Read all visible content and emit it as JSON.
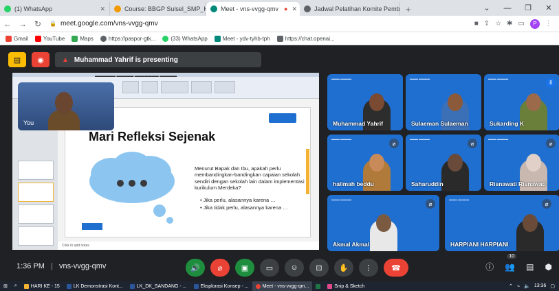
{
  "browser": {
    "tabs": [
      {
        "label": "(1) WhatsApp",
        "color": "#25d366",
        "active": false
      },
      {
        "label": "Course: BBGP Sulsel_SMP_Kelas_",
        "color": "#f29900",
        "active": false
      },
      {
        "label": "Meet - vns-vvgg-qmv",
        "color": "#00897b",
        "active": true
      },
      {
        "label": "Jadwal Pelatihan Komite Pembel",
        "color": "#5f6368",
        "active": false
      }
    ],
    "new_tab": "+",
    "url": "meet.google.com/vns-vvgg-qmv",
    "bookmarks": [
      {
        "label": "Gmail",
        "color": "#ea4335"
      },
      {
        "label": "YouTube",
        "color": "#ff0000"
      },
      {
        "label": "Maps",
        "color": "#34a853"
      },
      {
        "label": "https://paspor-gtk...",
        "color": "#5f6368"
      },
      {
        "label": "(33) WhatsApp",
        "color": "#25d366"
      },
      {
        "label": "Meet - ydv-tyhb-tph",
        "color": "#00897b"
      },
      {
        "label": "https://chat.openai...",
        "color": "#5f6368"
      }
    ],
    "profile_initial": "P"
  },
  "meet": {
    "presenting_label": "Muhammad Yahrif is presenting",
    "you_label": "You",
    "slide": {
      "title": "Mari Refleksi Sejenak",
      "question": "Menurut Bapak dan Ibu, apakah perlu membandingkan-bandingkan capaian sekolah sendiri dengan sekolah lain dalam implementasi kurikulum Merdeka?",
      "bullets": [
        "Jika perlu, alasannya karena …",
        "Jika tidak perlu, alasannya karena …"
      ],
      "notes": "Click to add notes"
    },
    "participants": [
      {
        "name": "Muhammad Yahrif",
        "muted": false,
        "skin": "#7a4a32",
        "shirt": "#2d2d2d"
      },
      {
        "name": "Sulaeman Sulaeman",
        "muted": false,
        "skin": "#8a5a3a",
        "shirt": "#3b6fb6"
      },
      {
        "name": "Sukarding K",
        "muted": false,
        "skin": "#9a6a4a",
        "shirt": "#6a7f3a"
      },
      {
        "name": "halimah beddu",
        "muted": true,
        "skin": "#c98a5a",
        "shirt": "#b07a3a"
      },
      {
        "name": "Saharuddin",
        "muted": true,
        "skin": "#6a4a3a",
        "shirt": "#2a2a2a"
      },
      {
        "name": "Risnawati Risnawati",
        "muted": true,
        "skin": "#e0d0c8",
        "shirt": "#c8b8b0"
      },
      {
        "name": "Akmal Akmal",
        "muted": true,
        "skin": "#7a5a40",
        "shirt": "#e8e8e8"
      },
      {
        "name": "HARPIANI HARPIANI",
        "muted": true,
        "skin": "#6a4a38",
        "shirt": "#2a2a2a"
      }
    ],
    "time": "1:36 PM",
    "meeting_code": "vns-vvgg-qmv",
    "people_count": "10"
  },
  "taskbar": {
    "items": [
      {
        "label": "HARI KE - 15",
        "color": "#f2b233",
        "active": false
      },
      {
        "label": "LK Demonstrasi Kont...",
        "color": "#2b579a",
        "active": false
      },
      {
        "label": "LK_DK_SANDANG - ...",
        "color": "#2b579a",
        "active": false
      },
      {
        "label": "Eksplorasi Konsep - ...",
        "color": "#2b579a",
        "active": false
      },
      {
        "label": "Meet - vns-vvgg-qm...",
        "color": "#ea4335",
        "active": true
      },
      {
        "label": "Snip & Sketch",
        "color": "#e04a8a",
        "active": false
      }
    ],
    "clock": "13:36"
  }
}
